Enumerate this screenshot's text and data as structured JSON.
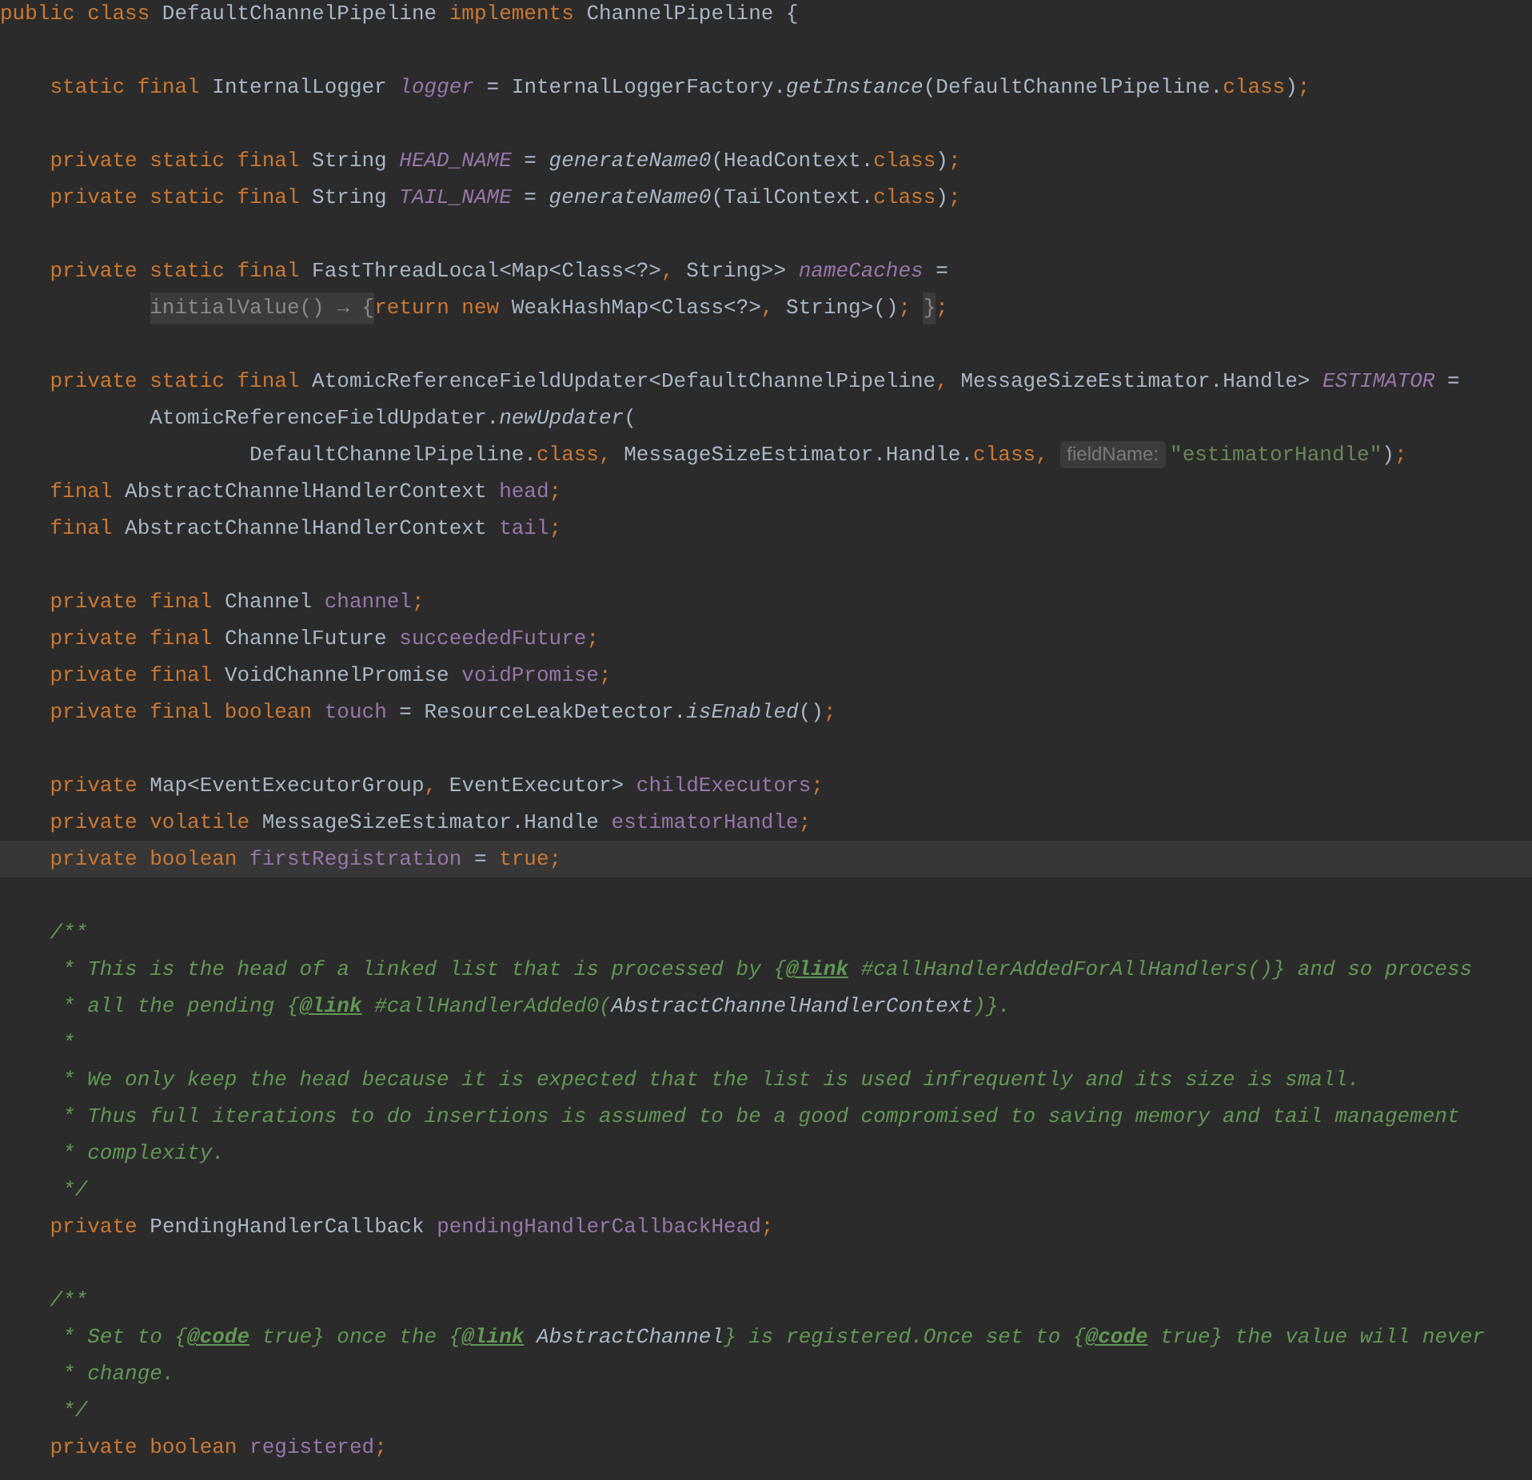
{
  "editor": {
    "lines": [
      {
        "current": false,
        "tokens": [
          {
            "kind": "keyword",
            "text": "public class "
          },
          {
            "kind": "plain",
            "text": "DefaultChannelPipeline "
          },
          {
            "kind": "keyword",
            "text": "implements "
          },
          {
            "kind": "plain",
            "text": "ChannelPipeline {"
          }
        ]
      },
      {
        "current": false
      },
      {
        "current": false,
        "tokens": [
          {
            "kind": "keyword",
            "text": "    static final "
          },
          {
            "kind": "plain",
            "text": "InternalLogger "
          },
          {
            "kind": "static_field",
            "text": "logger"
          },
          {
            "kind": "plain",
            "text": " = InternalLoggerFactory."
          },
          {
            "kind": "static_method",
            "text": "getInstance"
          },
          {
            "kind": "plain",
            "text": "(DefaultChannelPipeline."
          },
          {
            "kind": "keyword",
            "text": "class"
          },
          {
            "kind": "plain",
            "text": ")"
          },
          {
            "kind": "punct",
            "text": ";"
          }
        ]
      },
      {
        "current": false
      },
      {
        "current": false,
        "tokens": [
          {
            "kind": "keyword",
            "text": "    private static final "
          },
          {
            "kind": "plain",
            "text": "String "
          },
          {
            "kind": "static_field",
            "text": "HEAD_NAME"
          },
          {
            "kind": "plain",
            "text": " = "
          },
          {
            "kind": "static_method",
            "text": "generateName0"
          },
          {
            "kind": "plain",
            "text": "(HeadContext."
          },
          {
            "kind": "keyword",
            "text": "class"
          },
          {
            "kind": "plain",
            "text": ")"
          },
          {
            "kind": "punct",
            "text": ";"
          }
        ]
      },
      {
        "current": false,
        "tokens": [
          {
            "kind": "keyword",
            "text": "    private static final "
          },
          {
            "kind": "plain",
            "text": "String "
          },
          {
            "kind": "static_field",
            "text": "TAIL_NAME"
          },
          {
            "kind": "plain",
            "text": " = "
          },
          {
            "kind": "static_method",
            "text": "generateName0"
          },
          {
            "kind": "plain",
            "text": "(TailContext."
          },
          {
            "kind": "keyword",
            "text": "class"
          },
          {
            "kind": "plain",
            "text": ")"
          },
          {
            "kind": "punct",
            "text": ";"
          }
        ]
      },
      {
        "current": false
      },
      {
        "current": false,
        "tokens": [
          {
            "kind": "keyword",
            "text": "    private static final "
          },
          {
            "kind": "plain",
            "text": "FastThreadLocal<Map<Class<?>"
          },
          {
            "kind": "punct",
            "text": ","
          },
          {
            "kind": "plain",
            "text": " String>> "
          },
          {
            "kind": "static_field",
            "text": "nameCaches"
          },
          {
            "kind": "plain",
            "text": " ="
          }
        ]
      },
      {
        "current": false,
        "tokens": [
          {
            "kind": "fold",
            "text": "            initialValue() → {"
          },
          {
            "kind": "keyword",
            "text": "return new "
          },
          {
            "kind": "plain",
            "text": "WeakHashMap<Class<?>"
          },
          {
            "kind": "punct",
            "text": ","
          },
          {
            "kind": "plain",
            "text": " String>()"
          },
          {
            "kind": "punct",
            "text": "; "
          },
          {
            "kind": "fold",
            "text": "}"
          },
          {
            "kind": "punct",
            "text": ";"
          }
        ]
      },
      {
        "current": false
      },
      {
        "current": false,
        "tokens": [
          {
            "kind": "keyword",
            "text": "    private static final "
          },
          {
            "kind": "plain",
            "text": "AtomicReferenceFieldUpdater<DefaultChannelPipeline"
          },
          {
            "kind": "punct",
            "text": ","
          },
          {
            "kind": "plain",
            "text": " MessageSizeEstimator.Handle> "
          },
          {
            "kind": "static_field",
            "text": "ESTIMATOR"
          },
          {
            "kind": "plain",
            "text": " ="
          }
        ]
      },
      {
        "current": false,
        "tokens": [
          {
            "kind": "plain",
            "text": "            AtomicReferenceFieldUpdater."
          },
          {
            "kind": "static_method",
            "text": "newUpdater"
          },
          {
            "kind": "plain",
            "text": "("
          }
        ]
      },
      {
        "current": false,
        "tokens": [
          {
            "kind": "plain",
            "text": "                    DefaultChannelPipeline."
          },
          {
            "kind": "keyword",
            "text": "class"
          },
          {
            "kind": "punct",
            "text": ","
          },
          {
            "kind": "plain",
            "text": " MessageSizeEstimator.Handle."
          },
          {
            "kind": "keyword",
            "text": "class"
          },
          {
            "kind": "punct",
            "text": ", "
          },
          {
            "kind": "hint",
            "text": "fieldName:"
          },
          {
            "kind": "string",
            "text": "\"estimatorHandle\""
          },
          {
            "kind": "plain",
            "text": ")"
          },
          {
            "kind": "punct",
            "text": ";"
          }
        ]
      },
      {
        "current": false,
        "tokens": [
          {
            "kind": "keyword",
            "text": "    final "
          },
          {
            "kind": "plain",
            "text": "AbstractChannelHandlerContext "
          },
          {
            "kind": "field",
            "text": "head"
          },
          {
            "kind": "punct",
            "text": ";"
          }
        ]
      },
      {
        "current": false,
        "tokens": [
          {
            "kind": "keyword",
            "text": "    final "
          },
          {
            "kind": "plain",
            "text": "AbstractChannelHandlerContext "
          },
          {
            "kind": "field",
            "text": "tail"
          },
          {
            "kind": "punct",
            "text": ";"
          }
        ]
      },
      {
        "current": false
      },
      {
        "current": false,
        "tokens": [
          {
            "kind": "keyword",
            "text": "    private final "
          },
          {
            "kind": "plain",
            "text": "Channel "
          },
          {
            "kind": "field",
            "text": "channel"
          },
          {
            "kind": "punct",
            "text": ";"
          }
        ]
      },
      {
        "current": false,
        "tokens": [
          {
            "kind": "keyword",
            "text": "    private final "
          },
          {
            "kind": "plain",
            "text": "ChannelFuture "
          },
          {
            "kind": "field",
            "text": "succeededFuture"
          },
          {
            "kind": "punct",
            "text": ";"
          }
        ]
      },
      {
        "current": false,
        "tokens": [
          {
            "kind": "keyword",
            "text": "    private final "
          },
          {
            "kind": "plain",
            "text": "VoidChannelPromise "
          },
          {
            "kind": "field",
            "text": "voidPromise"
          },
          {
            "kind": "punct",
            "text": ";"
          }
        ]
      },
      {
        "current": false,
        "tokens": [
          {
            "kind": "keyword",
            "text": "    private final boolean "
          },
          {
            "kind": "field",
            "text": "touch"
          },
          {
            "kind": "plain",
            "text": " = ResourceLeakDetector."
          },
          {
            "kind": "static_method",
            "text": "isEnabled"
          },
          {
            "kind": "plain",
            "text": "()"
          },
          {
            "kind": "punct",
            "text": ";"
          }
        ]
      },
      {
        "current": false
      },
      {
        "current": false,
        "tokens": [
          {
            "kind": "keyword",
            "text": "    private "
          },
          {
            "kind": "plain",
            "text": "Map<EventExecutorGroup"
          },
          {
            "kind": "punct",
            "text": ","
          },
          {
            "kind": "plain",
            "text": " EventExecutor> "
          },
          {
            "kind": "field",
            "text": "childExecutors"
          },
          {
            "kind": "punct",
            "text": ";"
          }
        ]
      },
      {
        "current": false,
        "tokens": [
          {
            "kind": "keyword",
            "text": "    private volatile "
          },
          {
            "kind": "plain",
            "text": "MessageSizeEstimator.Handle "
          },
          {
            "kind": "field",
            "text": "estimatorHandle"
          },
          {
            "kind": "punct",
            "text": ";"
          }
        ]
      },
      {
        "current": true,
        "tokens": [
          {
            "kind": "keyword",
            "text": "    private boolean "
          },
          {
            "kind": "field",
            "text": "firstRegistration"
          },
          {
            "kind": "plain",
            "text": " = "
          },
          {
            "kind": "keyword",
            "text": "true"
          },
          {
            "kind": "punct",
            "text": ";"
          }
        ]
      },
      {
        "current": false
      },
      {
        "current": false,
        "tokens": [
          {
            "kind": "doc",
            "text": "    /**"
          }
        ]
      },
      {
        "current": false,
        "tokens": [
          {
            "kind": "doc",
            "text": "     * This is the head of a linked list that is processed by {"
          },
          {
            "kind": "doc_tag",
            "text": "@link"
          },
          {
            "kind": "doc",
            "text": " #callHandlerAddedForAllHandlers()} and so process"
          }
        ]
      },
      {
        "current": false,
        "tokens": [
          {
            "kind": "doc",
            "text": "     * all the pending {"
          },
          {
            "kind": "doc_tag",
            "text": "@link"
          },
          {
            "kind": "doc",
            "text": " #callHandlerAdded0("
          },
          {
            "kind": "doc_ref",
            "text": "AbstractChannelHandlerContext"
          },
          {
            "kind": "doc",
            "text": ")}."
          }
        ]
      },
      {
        "current": false,
        "tokens": [
          {
            "kind": "doc",
            "text": "     *"
          }
        ]
      },
      {
        "current": false,
        "tokens": [
          {
            "kind": "doc",
            "text": "     * We only keep the head because it is expected that the list is used infrequently and its size is small."
          }
        ]
      },
      {
        "current": false,
        "tokens": [
          {
            "kind": "doc",
            "text": "     * Thus full iterations to do insertions is assumed to be a good compromised to saving memory and tail management"
          }
        ]
      },
      {
        "current": false,
        "tokens": [
          {
            "kind": "doc",
            "text": "     * complexity."
          }
        ]
      },
      {
        "current": false,
        "tokens": [
          {
            "kind": "doc",
            "text": "     */"
          }
        ]
      },
      {
        "current": false,
        "tokens": [
          {
            "kind": "keyword",
            "text": "    private "
          },
          {
            "kind": "plain",
            "text": "PendingHandlerCallback "
          },
          {
            "kind": "field",
            "text": "pendingHandlerCallbackHead"
          },
          {
            "kind": "punct",
            "text": ";"
          }
        ]
      },
      {
        "current": false
      },
      {
        "current": false,
        "tokens": [
          {
            "kind": "doc",
            "text": "    /**"
          }
        ]
      },
      {
        "current": false,
        "tokens": [
          {
            "kind": "doc",
            "text": "     * Set to {"
          },
          {
            "kind": "doc_tag",
            "text": "@code"
          },
          {
            "kind": "doc",
            "text": " true} once the {"
          },
          {
            "kind": "doc_tag",
            "text": "@link"
          },
          {
            "kind": "doc_ref",
            "text": " AbstractChannel"
          },
          {
            "kind": "doc",
            "text": "} is registered.Once set to {"
          },
          {
            "kind": "doc_tag",
            "text": "@code"
          },
          {
            "kind": "doc",
            "text": " true} the value will never"
          }
        ]
      },
      {
        "current": false,
        "tokens": [
          {
            "kind": "doc",
            "text": "     * change."
          }
        ]
      },
      {
        "current": false,
        "tokens": [
          {
            "kind": "doc",
            "text": "     */"
          }
        ]
      },
      {
        "current": false,
        "tokens": [
          {
            "kind": "keyword",
            "text": "    private boolean "
          },
          {
            "kind": "field",
            "text": "registered"
          },
          {
            "kind": "punct",
            "text": ";"
          }
        ]
      }
    ]
  }
}
